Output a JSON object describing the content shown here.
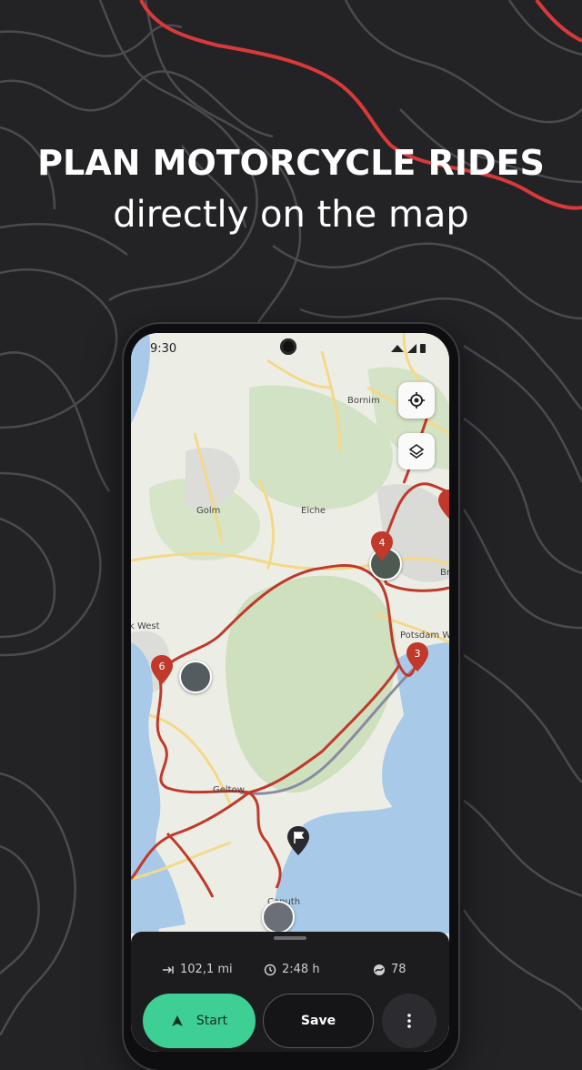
{
  "headline": {
    "title": "PLAN MOTORCYCLE RIDES",
    "subtitle": "directly on the map"
  },
  "status_bar": {
    "time": "9:30"
  },
  "map": {
    "places": [
      "Golm",
      "Eiche",
      "Bornim",
      "Potsdam W",
      "k West",
      "Geltow",
      "Caputh",
      "Br",
      "Golm"
    ],
    "waypoints": [
      "6",
      "4",
      "3"
    ],
    "accent_color": "#c0392b",
    "route_color": "#c0392b",
    "water_color": "#a8c8e8",
    "forest_color": "#cfe0c0"
  },
  "controls": {
    "locate_icon": "locate-icon",
    "layers_icon": "layers-icon"
  },
  "sheet": {
    "distance": "102,1 mi",
    "duration": "2:48 h",
    "curviness": "78",
    "start_label": "Start",
    "save_label": "Save"
  }
}
